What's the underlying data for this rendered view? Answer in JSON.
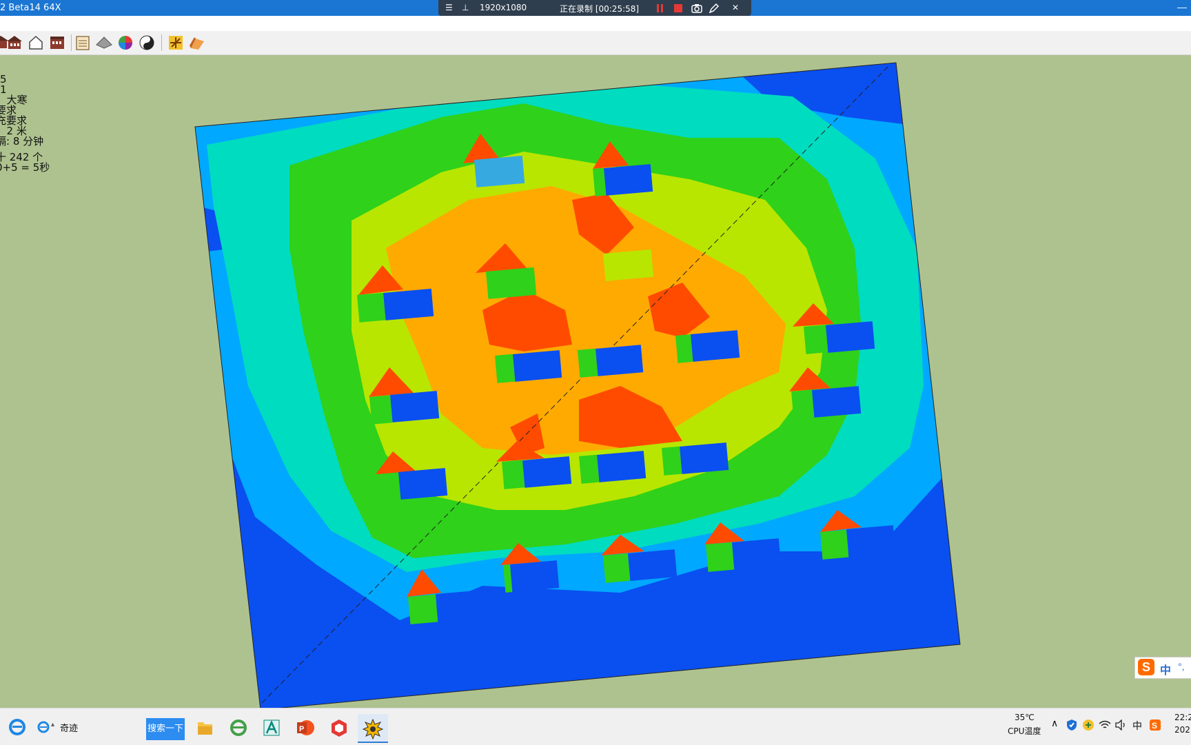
{
  "window": {
    "title": "2 Beta14 64X",
    "minimize_glyph": "—"
  },
  "recorder": {
    "menu_glyph": "☰",
    "pin_glyph": "⊥",
    "resolution": "1920x1080",
    "status": "正在录制 [00:25:58]",
    "pause_icon": "pause-icon",
    "stop_icon": "stop-icon",
    "camera_icon": "camera-icon",
    "pen_icon": "pen-icon",
    "close_glyph": "✕"
  },
  "toolbar": {
    "icons": [
      "partial-house-icon",
      "house-icon",
      "house-outline-icon",
      "building-icon",
      "calendar-icon",
      "roof-icon",
      "color-wheel-icon",
      "yin-yang-icon",
      "sun-arrow-icon",
      "shadow-icon"
    ]
  },
  "info_panel": {
    "lines": [
      "5",
      "1",
      "  大寒",
      "要求",
      "充要求",
      "  2 米",
      "隔: 8 分钟",
      "",
      "十 242 个",
      "0+5 = 5秒"
    ]
  },
  "ime": {
    "logo": "S",
    "mode": "中",
    "punct": "°,"
  },
  "taskbar": {
    "search_button": "搜索一下",
    "browser_label": "奇迹",
    "apps": [
      "file-explorer-icon",
      "ie-green-icon",
      "a-app-icon",
      "powerpoint-icon",
      "sketchup-icon",
      "sun-plugin-icon"
    ],
    "cpu_temp": "35℃",
    "cpu_label": "CPU温度",
    "ime_indicator": "中",
    "clock_time": "22:2",
    "clock_date": "202"
  },
  "colors": {
    "titlebar": "#1a76d2",
    "recorder": "#2f3e4e",
    "viewport_bg": "#aec28f",
    "map_blue": "#0a4ff0",
    "map_red": "#ff4b00"
  }
}
